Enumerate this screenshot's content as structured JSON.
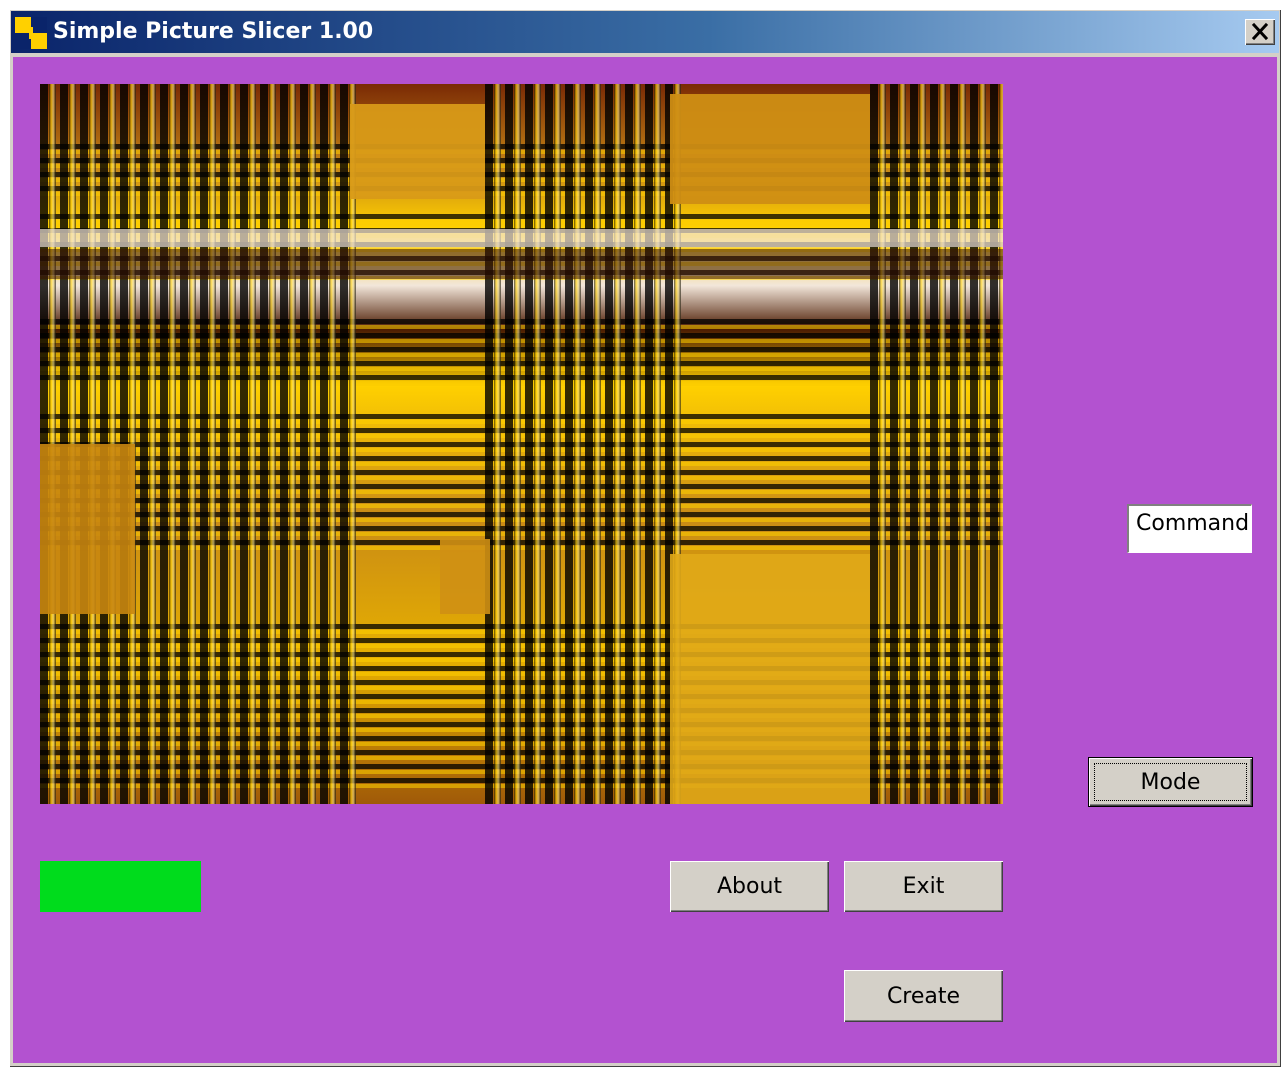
{
  "window": {
    "title": "Simple Picture Slicer 1.00",
    "close_label": "×",
    "background_color": "#b352d0"
  },
  "picture": {
    "palette": [
      "#000000",
      "#c98a16",
      "#ffd000",
      "#ffe98a",
      "#7a2a05",
      "#f2e6da"
    ]
  },
  "status_indicator": {
    "color": "#00dc1c"
  },
  "buttons": {
    "about": "About",
    "exit": "Exit",
    "create": "Create",
    "mode": "Mode"
  },
  "command_label": "Command"
}
